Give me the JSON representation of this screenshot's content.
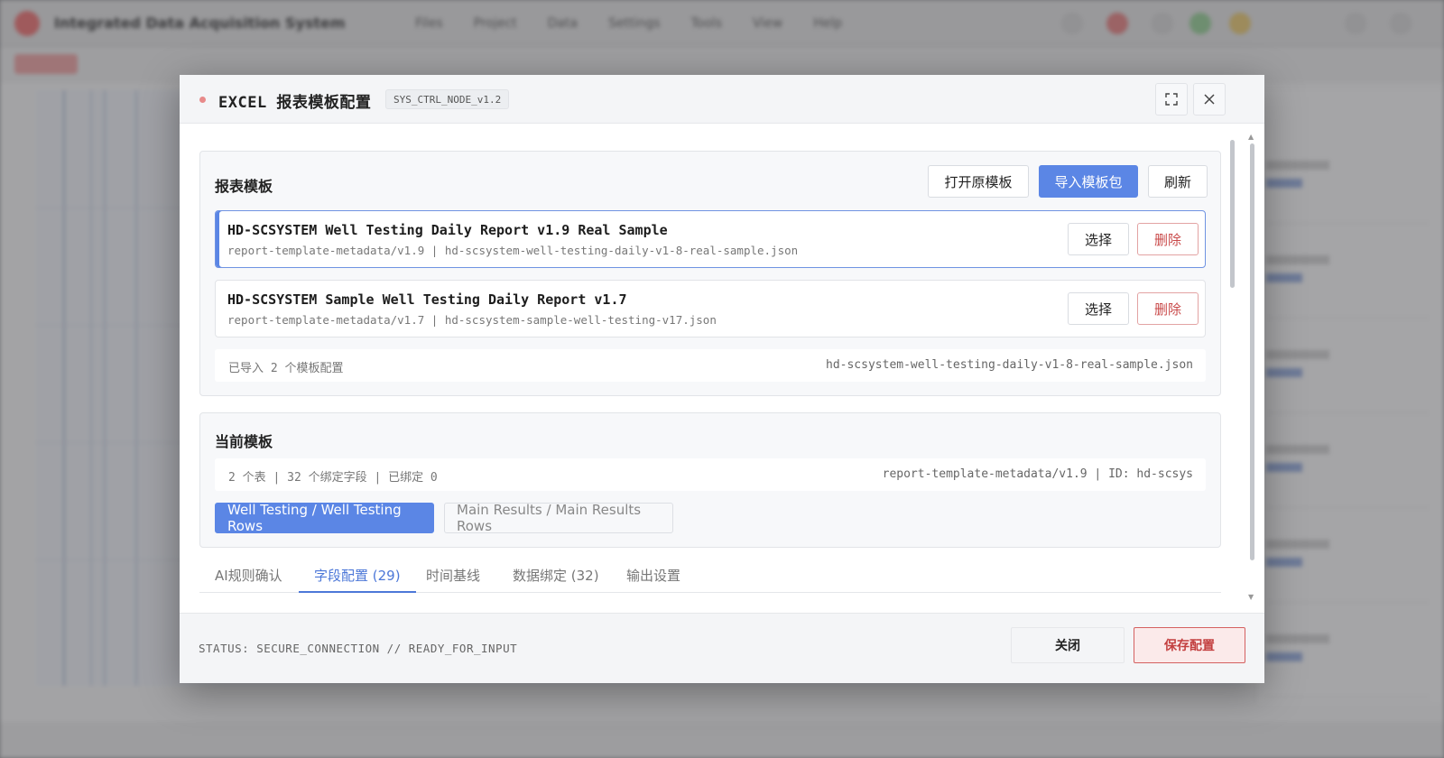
{
  "background_app": {
    "title": "Integrated Data Acquisition System",
    "menu": [
      "Files",
      "Project",
      "Data",
      "Settings",
      "Tools",
      "View",
      "Help"
    ]
  },
  "modal": {
    "title": "EXCEL 报表模板配置",
    "version_badge": "SYS_CTRL_NODE_v1.2",
    "maximize_icon": "expand-icon",
    "close_icon": "close-icon",
    "report_templates": {
      "title": "报表模板",
      "buttons": {
        "open_original": "打开原模板",
        "import_package": "导入模板包",
        "refresh": "刷新"
      },
      "items": [
        {
          "name": "HD-SCSYSTEM Well Testing Daily Report v1.9 Real Sample",
          "meta": "report-template-metadata/v1.9 | hd-scsystem-well-testing-daily-v1-8-real-sample.json",
          "select_label": "选择",
          "delete_label": "删除",
          "selected": true
        },
        {
          "name": "HD-SCSYSTEM Sample Well Testing Daily Report v1.7",
          "meta": "report-template-metadata/v1.7 | hd-scsystem-sample-well-testing-v17.json",
          "select_label": "选择",
          "delete_label": "删除",
          "selected": false
        }
      ],
      "summary_left": "已导入 2 个模板配置",
      "summary_right": "hd-scsystem-well-testing-daily-v1-8-real-sample.json"
    },
    "current_template": {
      "title": "当前模板",
      "summary_left": "2 个表 | 32 个绑定字段 | 已绑定 0",
      "summary_right": "report-template-metadata/v1.9 | ID: hd-scsys",
      "sheets": [
        {
          "label": "Well Testing / Well Testing Rows",
          "active": true
        },
        {
          "label": "Main Results / Main Results Rows",
          "active": false
        }
      ]
    },
    "tabs": [
      {
        "label": "AI规则确认",
        "active": false
      },
      {
        "label": "字段配置 (29)",
        "active": true
      },
      {
        "label": "时间基线",
        "active": false
      },
      {
        "label": "数据绑定 (32)",
        "active": false
      },
      {
        "label": "输出设置",
        "active": false
      }
    ],
    "footer": {
      "status": "STATUS: SECURE_CONNECTION // READY_FOR_INPUT",
      "close_label": "关闭",
      "save_label": "保存配置"
    }
  },
  "colors": {
    "primary": "#5b86e5",
    "danger": "#c94a4a",
    "status_dot": "#e88a8a"
  }
}
